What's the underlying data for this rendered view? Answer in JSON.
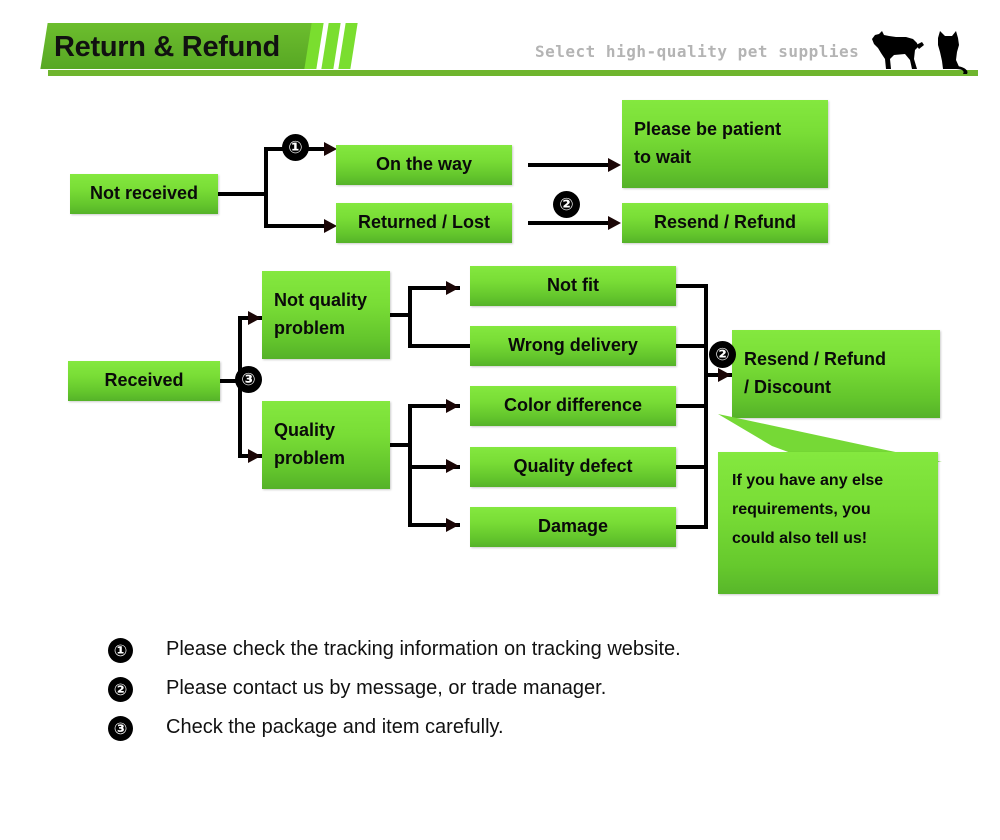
{
  "header": {
    "title": "Return & Refund",
    "tagline": "Select high-quality pet supplies",
    "accent_color": "#62b229",
    "stripe_color": "#7ade2f",
    "tagline_color": "#b4b4b4",
    "pets": [
      "dog-silhouette",
      "cat-silhouette"
    ]
  },
  "theme": {
    "box_gradient_top": "#84e83f",
    "box_gradient_bottom": "#55b229",
    "connector_color": "#000000",
    "badge_bg": "#000000",
    "badge_text": "#ffffff"
  },
  "flow_top": {
    "source": "Not received",
    "branch_badge": "①",
    "branches": [
      {
        "label": "On the way",
        "outcome": "Please be patient to wait",
        "outcome_badge": ""
      },
      {
        "label": "Returned / Lost",
        "outcome": "Resend / Refund",
        "outcome_badge": "②"
      }
    ],
    "outcome_1_line1": "Please be patient",
    "outcome_1_line2": "to wait",
    "outcome_2": "Resend / Refund"
  },
  "flow_bottom": {
    "source": "Received",
    "branch_badge": "③",
    "categories": [
      {
        "line1": "Not quality",
        "line2": "problem",
        "reasons": [
          "Not fit",
          "Wrong delivery"
        ]
      },
      {
        "line1": "Quality",
        "line2": "problem",
        "reasons": [
          "Color difference",
          "Quality defect",
          "Damage"
        ]
      }
    ],
    "reasons_flat": [
      "Not fit",
      "Wrong delivery",
      "Color difference",
      "Quality defect",
      "Damage"
    ],
    "outcome_badge": "②",
    "outcome_line1": "Resend / Refund",
    "outcome_line2": "/ Discount",
    "callout_line1": "If you have any else",
    "callout_line2": "requirements, you",
    "callout_line3": "could also tell us!"
  },
  "notes": [
    {
      "badge": "①",
      "text": "Please check the tracking information on tracking website."
    },
    {
      "badge": "②",
      "text": "Please contact us by message, or trade manager."
    },
    {
      "badge": "③",
      "text": "Check the package and item carefully."
    }
  ]
}
